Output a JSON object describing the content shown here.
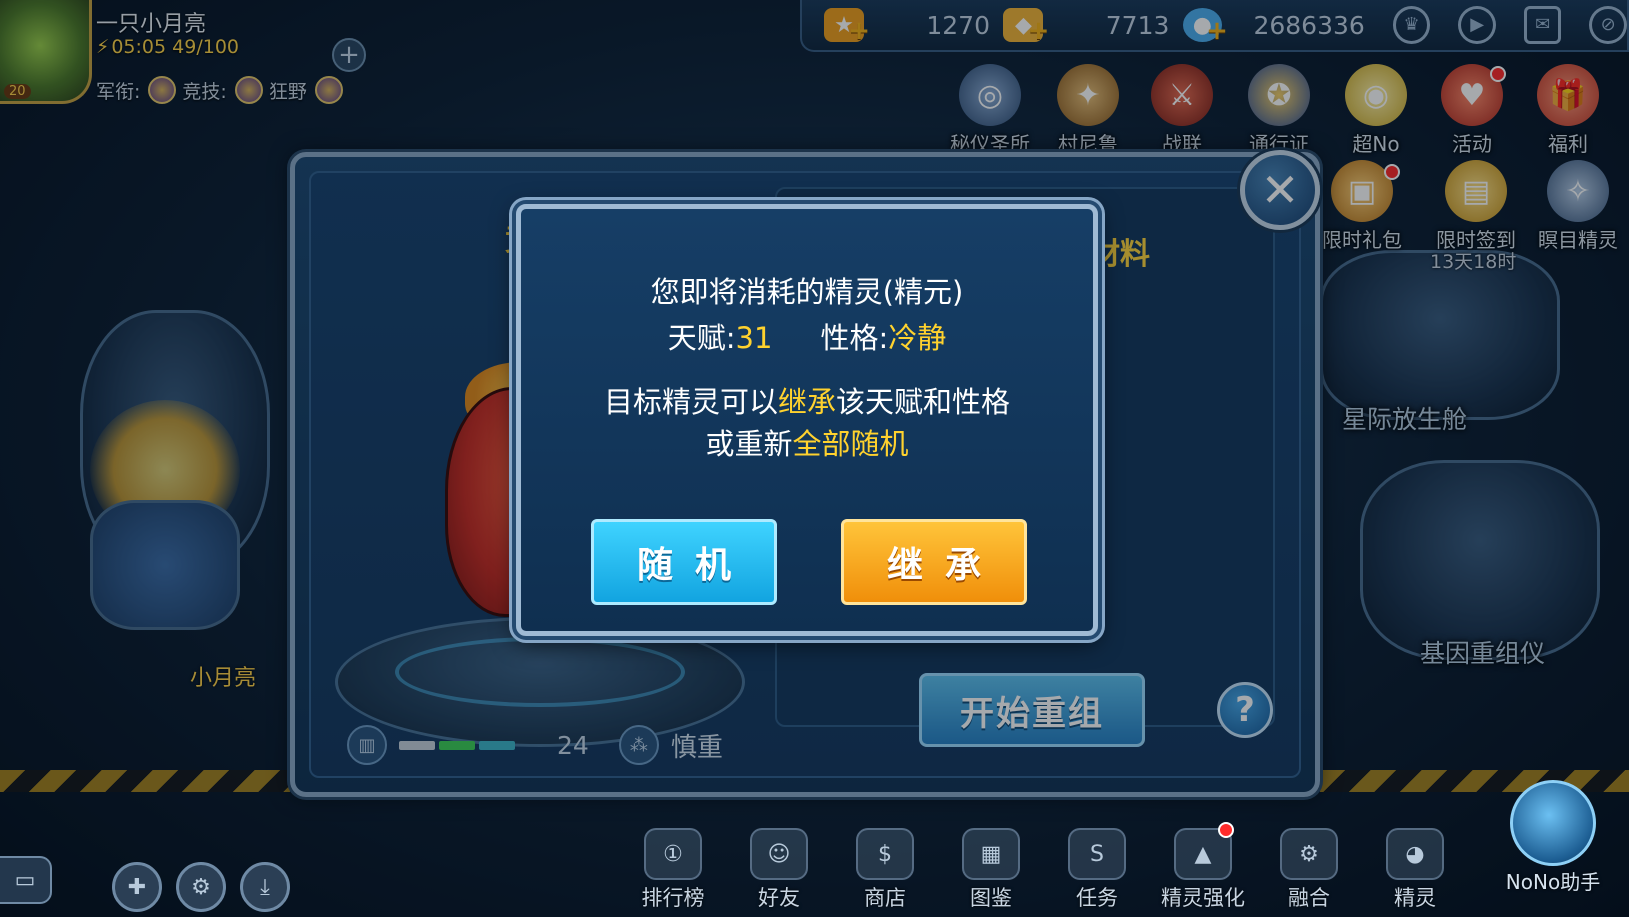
{
  "player": {
    "name": "一只小月亮",
    "level": "20",
    "energy_time": "05:05",
    "energy": "49/100",
    "rank_labels": [
      "军衔:",
      "竞技:",
      "狂野"
    ]
  },
  "currencies": [
    {
      "icon": "ticket-icon",
      "value": "1270",
      "color": "#f0a020"
    },
    {
      "icon": "gold-icon",
      "value": "7713",
      "color": "#f3b53a"
    },
    {
      "icon": "diamond-icon",
      "value": "2686336",
      "color": "#4fb0f0"
    }
  ],
  "top_icons": [
    "trophy-icon",
    "play-icon",
    "mail-icon",
    "hide-icon"
  ],
  "activities": [
    {
      "name": "activity-secret-shrine",
      "label": "秘仪圣所",
      "icon": "shrine-icon",
      "color": "#5f7fa8",
      "dot": false
    },
    {
      "name": "activity-cunilu",
      "label": "村尼鲁",
      "icon": "cunilu-icon",
      "color": "#c89540",
      "dot": false
    },
    {
      "name": "activity-war-alliance",
      "label": "战联",
      "icon": "war-alliance-icon",
      "color": "#b83a2a",
      "dot": false
    },
    {
      "name": "activity-pass",
      "label": "通行证",
      "icon": "pass-icon",
      "color": "#d7a534",
      "dot": false
    },
    {
      "name": "activity-super-no",
      "label": "超No",
      "icon": "super-no-icon",
      "color": "#e6d15a",
      "dot": false
    },
    {
      "name": "activity-events",
      "label": "活动",
      "icon": "events-icon",
      "color": "#e24a3c",
      "dot": true
    },
    {
      "name": "activity-welfare",
      "label": "福利",
      "icon": "welfare-icon",
      "color": "#e65a4a",
      "dot": false
    }
  ],
  "promos": [
    {
      "name": "promo-limited-pack",
      "label": "限时礼包",
      "icon": "gift-icon",
      "color": "#e0a030",
      "dot": true
    },
    {
      "name": "promo-limited-signin",
      "label": "限时签到",
      "icon": "signin-icon",
      "color": "#f1c14a",
      "dot": false
    },
    {
      "name": "promo-blink-sprite",
      "label": "瞑目精灵",
      "icon": "sprite-icon",
      "color": "#7fa0c6",
      "dot": false
    }
  ],
  "promo_timer": "13天18时",
  "scene": {
    "release_pod_label": "星际放生舱",
    "gene_machine_label": "基因重组仪",
    "character_tag": "小月亮"
  },
  "panel": {
    "left_title": "竞",
    "right_title": "材料",
    "stat_value": "24",
    "stat_segments": [
      "#c6d2dc",
      "#3fcf5a",
      "#3fb6c9"
    ],
    "nature_label": "慎重",
    "start_button_label": "开始重组",
    "help_label": "?",
    "close_label": "✕"
  },
  "dialog": {
    "line1": "您即将消耗的精灵(精元)",
    "talent_label": "天赋:",
    "talent_value": "31",
    "nature_label": "性格:",
    "nature_value": "冷静",
    "line3_prefix": "目标精灵可以",
    "line3_highlight": "继承",
    "line3_suffix": "该天赋和性格",
    "line4_prefix": "或重新",
    "line4_highlight": "全部随机",
    "btn_random": "随机",
    "btn_inherit": "继承"
  },
  "bottom_nav": [
    {
      "name": "nav-rankings",
      "label": "排行榜",
      "icon": "rank-icon",
      "dot": false
    },
    {
      "name": "nav-friends",
      "label": "好友",
      "icon": "friends-icon",
      "dot": false
    },
    {
      "name": "nav-shop",
      "label": "商店",
      "icon": "shop-icon",
      "dot": false
    },
    {
      "name": "nav-codex",
      "label": "图鉴",
      "icon": "codex-icon",
      "dot": false
    },
    {
      "name": "nav-tasks",
      "label": "任务",
      "icon": "tasks-icon",
      "dot": false
    },
    {
      "name": "nav-sprite-enhance",
      "label": "精灵强化",
      "icon": "enhance-icon",
      "dot": true
    },
    {
      "name": "nav-fusion",
      "label": "融合",
      "icon": "fusion-icon",
      "dot": false
    },
    {
      "name": "nav-sprites",
      "label": "精灵",
      "icon": "sprites-icon",
      "dot": false
    }
  ],
  "nono": {
    "label": "NoNo助手",
    "icon": "nono-icon"
  },
  "bottom_left_buttons": [
    "chat-icon",
    "crosshair-icon",
    "settings-icon",
    "download-icon"
  ]
}
